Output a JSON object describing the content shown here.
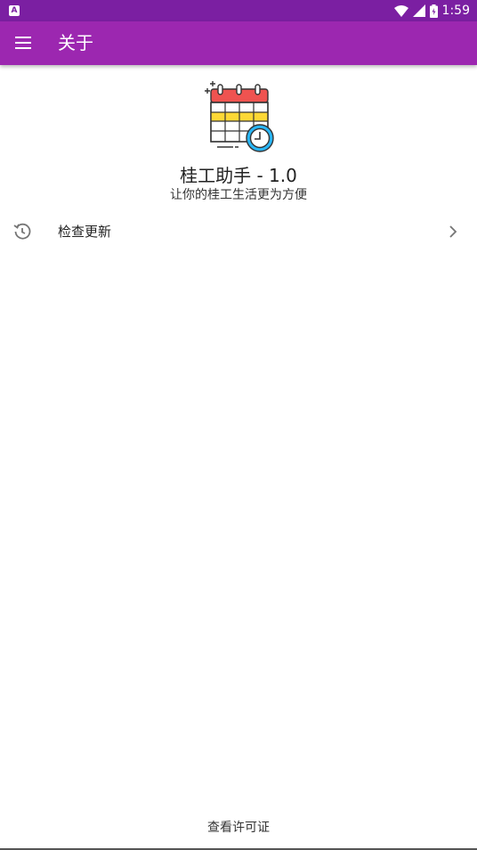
{
  "status_bar": {
    "time": "1:59",
    "notification_icon": "a-letter-icon",
    "notification_text": "A"
  },
  "app_bar": {
    "title": "关于",
    "background": "#9c27b0"
  },
  "about": {
    "app_name": "桂工助手 - 1.0",
    "slogan": "让你的桂工生活更为方便"
  },
  "list": {
    "check_update_label": "检查更新"
  },
  "footer": {
    "license_link": "查看许可证"
  },
  "colors": {
    "status_bar": "#7b1fa2",
    "accent": "#9c27b0",
    "calendar_red": "#ef5350",
    "calendar_yellow": "#fdd835",
    "clock_blue": "#29b6f6"
  }
}
